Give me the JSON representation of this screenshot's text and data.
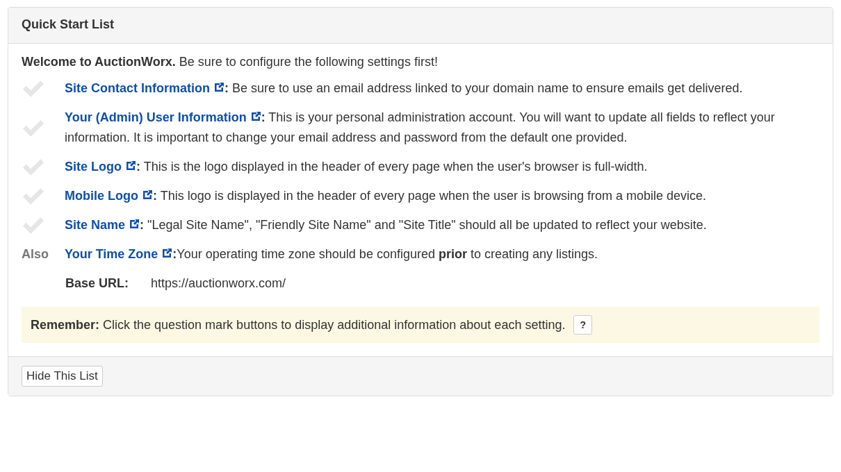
{
  "panel": {
    "title": "Quick Start List"
  },
  "intro": "**Welcome to AuctionWorx.** Be sure to configure the following settings first!",
  "items": [
    {
      "kind": "check",
      "done": false,
      "link": "Site Contact Information",
      "text": "**:** Be sure to use an email address linked to your domain name to ensure emails get delivered."
    },
    {
      "kind": "check",
      "done": false,
      "link": "Your (Admin) User Information",
      "text": "**:** This is your personal administration account. You will want to update all fields to reflect your information. It is important to change your email address and password from the default one provided."
    },
    {
      "kind": "check",
      "done": false,
      "link": "Site Logo",
      "text": "**:** This is the logo displayed in the header of every page when the user's browser is full-width."
    },
    {
      "kind": "check",
      "done": false,
      "link": "Mobile Logo",
      "text": "**:** This logo is displayed in the header of every page when the user is browsing from a mobile device."
    },
    {
      "kind": "check",
      "done": false,
      "link": "Site Name",
      "text": "**:** \"Legal Site Name\", \"Friendly Site Name\" and \"Site Title\" should all be updated to reflect your website."
    },
    {
      "kind": "also",
      "prefix": "Also",
      "link": "Your Time Zone",
      "text": "**:**Your operating time zone should be configured **prior** to creating any listings."
    }
  ],
  "base_url": {
    "label": "Base URL:",
    "value": "https://auctionworx.com/"
  },
  "remember": {
    "text": "**Remember:** Click the question mark buttons to display additional information about each setting.",
    "button": "?"
  },
  "footer": {
    "button": "Hide This List"
  }
}
